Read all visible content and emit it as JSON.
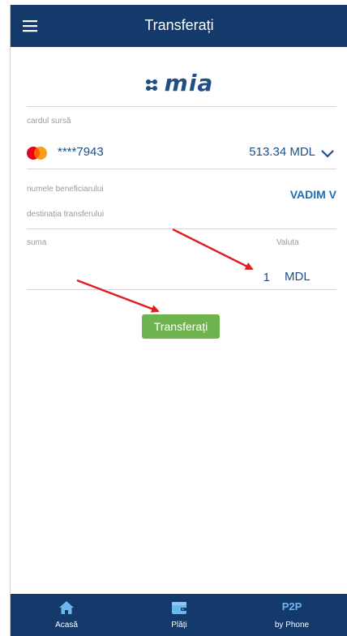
{
  "header": {
    "title": "Transferați",
    "menu_icon": "hamburger-menu-icon"
  },
  "logo": {
    "text": "mia",
    "icon": "mia-dots-logo-icon"
  },
  "source_card": {
    "label": "cardul sursă",
    "number": "****7943",
    "balance": "513.34 MDL",
    "brand_icon": "mastercard-icon",
    "dropdown_icon": "chevron-down-icon"
  },
  "beneficiary": {
    "label": "numele beneficiarului",
    "value": "VADIM V",
    "destination_label": "destinația transferului"
  },
  "amount": {
    "label": "suma",
    "value": "1",
    "currency_label": "Valuta",
    "currency_value": "MDL"
  },
  "actions": {
    "transfer_label": "Transferați"
  },
  "bottom_nav": {
    "items": [
      {
        "label": "Acasă",
        "icon": "home-icon"
      },
      {
        "label": "Plăți",
        "icon": "wallet-icon"
      },
      {
        "icon_text": "P2P",
        "label": "by Phone"
      }
    ]
  },
  "colors": {
    "primary": "#143a6b",
    "accent_text": "#1f4f86",
    "link_blue": "#1f6db3",
    "button_green": "#6fb34f",
    "annotation_red": "#e02020"
  }
}
